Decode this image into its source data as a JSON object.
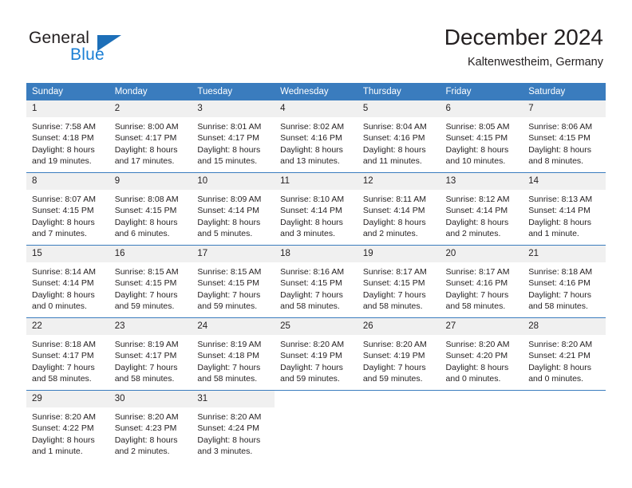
{
  "brand": {
    "name_primary": "General",
    "name_secondary": "Blue",
    "triangle_icon": "triangle-icon",
    "accent_color": "#1b7fd4",
    "logo_mark_color": "#1d6fb8"
  },
  "header": {
    "title": "December 2024",
    "subtitle": "Kaltenwestheim, Germany"
  },
  "theme": {
    "header_row_color": "#3a7cbe",
    "daynum_band_color": "#f0f0f0",
    "text_color": "#231f20",
    "cell_background": "#ffffff"
  },
  "weekday_headers": [
    "Sunday",
    "Monday",
    "Tuesday",
    "Wednesday",
    "Thursday",
    "Friday",
    "Saturday"
  ],
  "weeks": [
    [
      {
        "day": "1",
        "sunrise": "Sunrise: 7:58 AM",
        "sunset": "Sunset: 4:18 PM",
        "daylight_line1": "Daylight: 8 hours",
        "daylight_line2": "and 19 minutes."
      },
      {
        "day": "2",
        "sunrise": "Sunrise: 8:00 AM",
        "sunset": "Sunset: 4:17 PM",
        "daylight_line1": "Daylight: 8 hours",
        "daylight_line2": "and 17 minutes."
      },
      {
        "day": "3",
        "sunrise": "Sunrise: 8:01 AM",
        "sunset": "Sunset: 4:17 PM",
        "daylight_line1": "Daylight: 8 hours",
        "daylight_line2": "and 15 minutes."
      },
      {
        "day": "4",
        "sunrise": "Sunrise: 8:02 AM",
        "sunset": "Sunset: 4:16 PM",
        "daylight_line1": "Daylight: 8 hours",
        "daylight_line2": "and 13 minutes."
      },
      {
        "day": "5",
        "sunrise": "Sunrise: 8:04 AM",
        "sunset": "Sunset: 4:16 PM",
        "daylight_line1": "Daylight: 8 hours",
        "daylight_line2": "and 11 minutes."
      },
      {
        "day": "6",
        "sunrise": "Sunrise: 8:05 AM",
        "sunset": "Sunset: 4:15 PM",
        "daylight_line1": "Daylight: 8 hours",
        "daylight_line2": "and 10 minutes."
      },
      {
        "day": "7",
        "sunrise": "Sunrise: 8:06 AM",
        "sunset": "Sunset: 4:15 PM",
        "daylight_line1": "Daylight: 8 hours",
        "daylight_line2": "and 8 minutes."
      }
    ],
    [
      {
        "day": "8",
        "sunrise": "Sunrise: 8:07 AM",
        "sunset": "Sunset: 4:15 PM",
        "daylight_line1": "Daylight: 8 hours",
        "daylight_line2": "and 7 minutes."
      },
      {
        "day": "9",
        "sunrise": "Sunrise: 8:08 AM",
        "sunset": "Sunset: 4:15 PM",
        "daylight_line1": "Daylight: 8 hours",
        "daylight_line2": "and 6 minutes."
      },
      {
        "day": "10",
        "sunrise": "Sunrise: 8:09 AM",
        "sunset": "Sunset: 4:14 PM",
        "daylight_line1": "Daylight: 8 hours",
        "daylight_line2": "and 5 minutes."
      },
      {
        "day": "11",
        "sunrise": "Sunrise: 8:10 AM",
        "sunset": "Sunset: 4:14 PM",
        "daylight_line1": "Daylight: 8 hours",
        "daylight_line2": "and 3 minutes."
      },
      {
        "day": "12",
        "sunrise": "Sunrise: 8:11 AM",
        "sunset": "Sunset: 4:14 PM",
        "daylight_line1": "Daylight: 8 hours",
        "daylight_line2": "and 2 minutes."
      },
      {
        "day": "13",
        "sunrise": "Sunrise: 8:12 AM",
        "sunset": "Sunset: 4:14 PM",
        "daylight_line1": "Daylight: 8 hours",
        "daylight_line2": "and 2 minutes."
      },
      {
        "day": "14",
        "sunrise": "Sunrise: 8:13 AM",
        "sunset": "Sunset: 4:14 PM",
        "daylight_line1": "Daylight: 8 hours",
        "daylight_line2": "and 1 minute."
      }
    ],
    [
      {
        "day": "15",
        "sunrise": "Sunrise: 8:14 AM",
        "sunset": "Sunset: 4:14 PM",
        "daylight_line1": "Daylight: 8 hours",
        "daylight_line2": "and 0 minutes."
      },
      {
        "day": "16",
        "sunrise": "Sunrise: 8:15 AM",
        "sunset": "Sunset: 4:15 PM",
        "daylight_line1": "Daylight: 7 hours",
        "daylight_line2": "and 59 minutes."
      },
      {
        "day": "17",
        "sunrise": "Sunrise: 8:15 AM",
        "sunset": "Sunset: 4:15 PM",
        "daylight_line1": "Daylight: 7 hours",
        "daylight_line2": "and 59 minutes."
      },
      {
        "day": "18",
        "sunrise": "Sunrise: 8:16 AM",
        "sunset": "Sunset: 4:15 PM",
        "daylight_line1": "Daylight: 7 hours",
        "daylight_line2": "and 58 minutes."
      },
      {
        "day": "19",
        "sunrise": "Sunrise: 8:17 AM",
        "sunset": "Sunset: 4:15 PM",
        "daylight_line1": "Daylight: 7 hours",
        "daylight_line2": "and 58 minutes."
      },
      {
        "day": "20",
        "sunrise": "Sunrise: 8:17 AM",
        "sunset": "Sunset: 4:16 PM",
        "daylight_line1": "Daylight: 7 hours",
        "daylight_line2": "and 58 minutes."
      },
      {
        "day": "21",
        "sunrise": "Sunrise: 8:18 AM",
        "sunset": "Sunset: 4:16 PM",
        "daylight_line1": "Daylight: 7 hours",
        "daylight_line2": "and 58 minutes."
      }
    ],
    [
      {
        "day": "22",
        "sunrise": "Sunrise: 8:18 AM",
        "sunset": "Sunset: 4:17 PM",
        "daylight_line1": "Daylight: 7 hours",
        "daylight_line2": "and 58 minutes."
      },
      {
        "day": "23",
        "sunrise": "Sunrise: 8:19 AM",
        "sunset": "Sunset: 4:17 PM",
        "daylight_line1": "Daylight: 7 hours",
        "daylight_line2": "and 58 minutes."
      },
      {
        "day": "24",
        "sunrise": "Sunrise: 8:19 AM",
        "sunset": "Sunset: 4:18 PM",
        "daylight_line1": "Daylight: 7 hours",
        "daylight_line2": "and 58 minutes."
      },
      {
        "day": "25",
        "sunrise": "Sunrise: 8:20 AM",
        "sunset": "Sunset: 4:19 PM",
        "daylight_line1": "Daylight: 7 hours",
        "daylight_line2": "and 59 minutes."
      },
      {
        "day": "26",
        "sunrise": "Sunrise: 8:20 AM",
        "sunset": "Sunset: 4:19 PM",
        "daylight_line1": "Daylight: 7 hours",
        "daylight_line2": "and 59 minutes."
      },
      {
        "day": "27",
        "sunrise": "Sunrise: 8:20 AM",
        "sunset": "Sunset: 4:20 PM",
        "daylight_line1": "Daylight: 8 hours",
        "daylight_line2": "and 0 minutes."
      },
      {
        "day": "28",
        "sunrise": "Sunrise: 8:20 AM",
        "sunset": "Sunset: 4:21 PM",
        "daylight_line1": "Daylight: 8 hours",
        "daylight_line2": "and 0 minutes."
      }
    ],
    [
      {
        "day": "29",
        "sunrise": "Sunrise: 8:20 AM",
        "sunset": "Sunset: 4:22 PM",
        "daylight_line1": "Daylight: 8 hours",
        "daylight_line2": "and 1 minute."
      },
      {
        "day": "30",
        "sunrise": "Sunrise: 8:20 AM",
        "sunset": "Sunset: 4:23 PM",
        "daylight_line1": "Daylight: 8 hours",
        "daylight_line2": "and 2 minutes."
      },
      {
        "day": "31",
        "sunrise": "Sunrise: 8:20 AM",
        "sunset": "Sunset: 4:24 PM",
        "daylight_line1": "Daylight: 8 hours",
        "daylight_line2": "and 3 minutes."
      },
      {
        "day": "",
        "sunrise": "",
        "sunset": "",
        "daylight_line1": "",
        "daylight_line2": ""
      },
      {
        "day": "",
        "sunrise": "",
        "sunset": "",
        "daylight_line1": "",
        "daylight_line2": ""
      },
      {
        "day": "",
        "sunrise": "",
        "sunset": "",
        "daylight_line1": "",
        "daylight_line2": ""
      },
      {
        "day": "",
        "sunrise": "",
        "sunset": "",
        "daylight_line1": "",
        "daylight_line2": ""
      }
    ]
  ]
}
